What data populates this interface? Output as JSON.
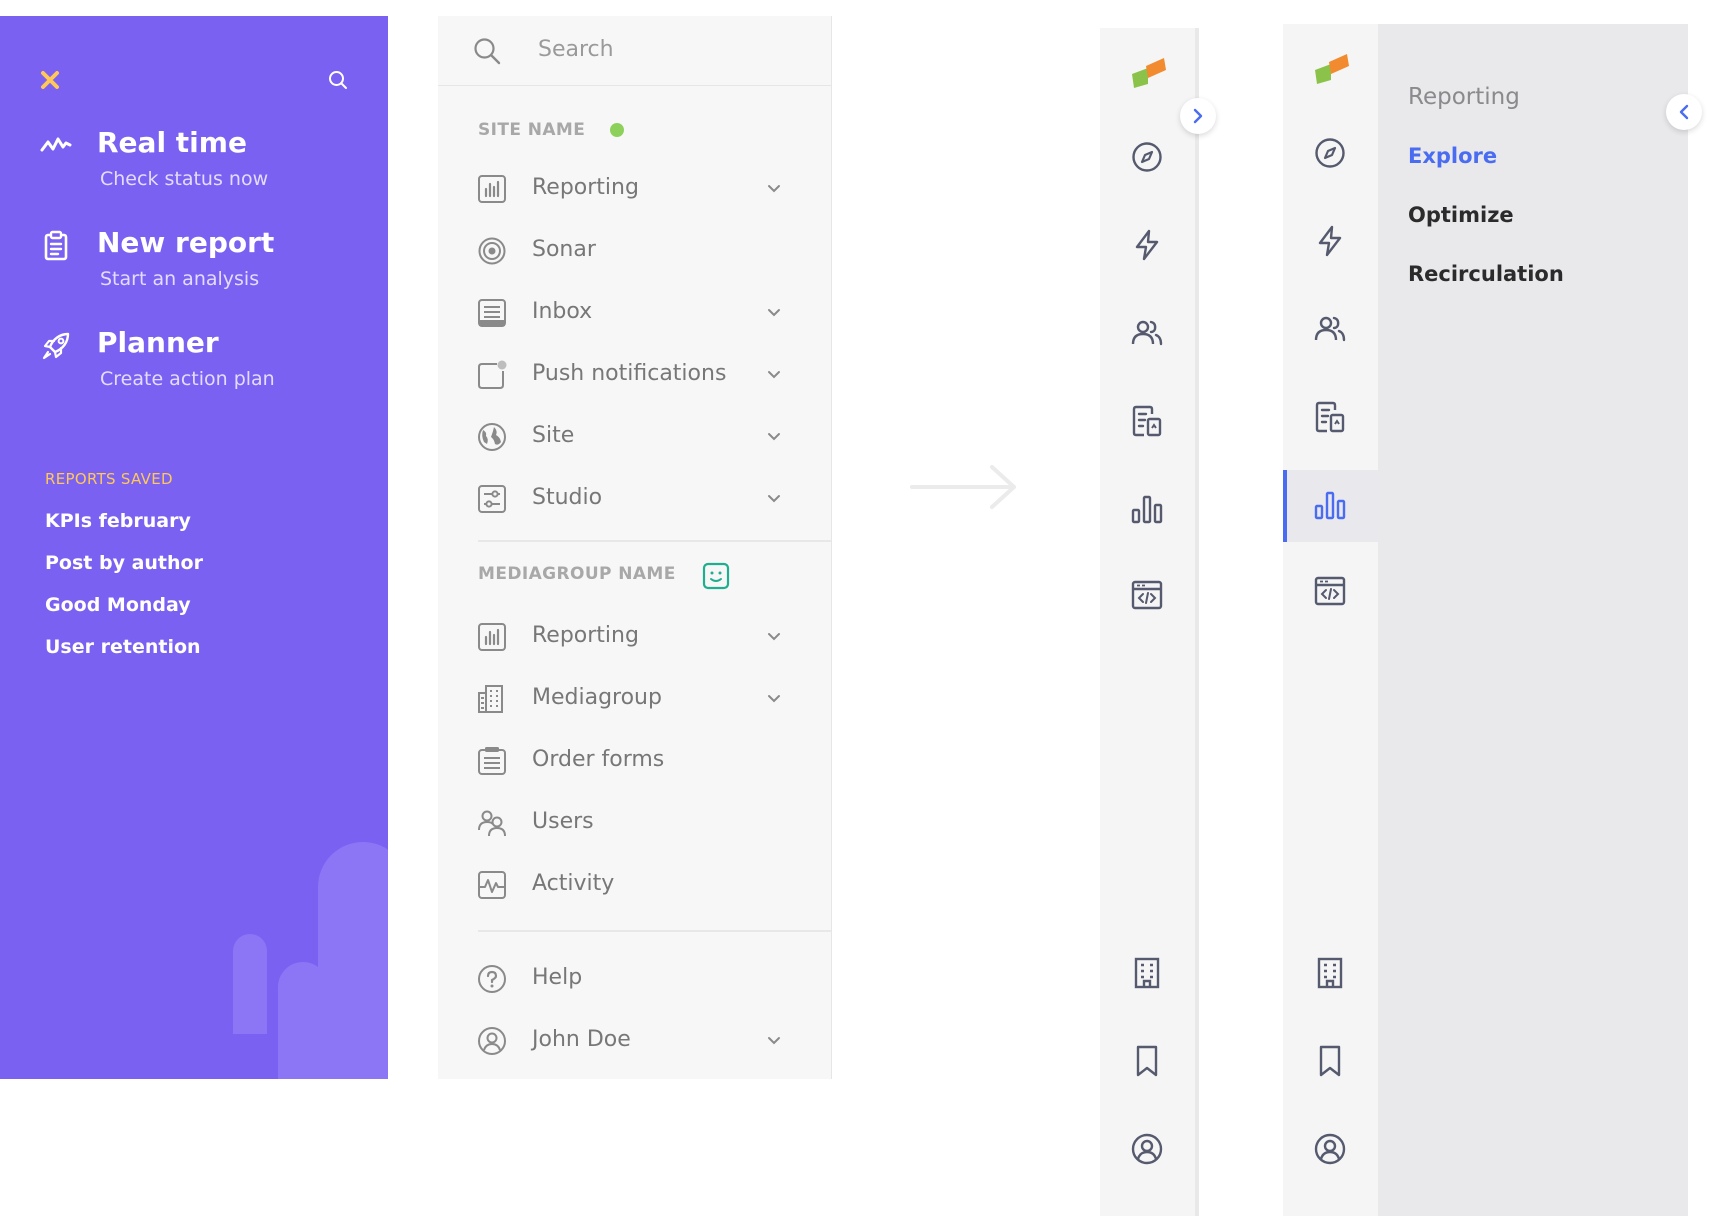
{
  "sidebar_purple": {
    "actions": [
      {
        "title": "Real time",
        "subtitle": "Check status now",
        "icon": "pulse-icon"
      },
      {
        "title": "New report",
        "subtitle": "Start an analysis",
        "icon": "clipboard-icon"
      },
      {
        "title": "Planner",
        "subtitle": "Create action plan",
        "icon": "rocket-icon"
      }
    ],
    "saved_header": "REPORTS SAVED",
    "saved_reports": [
      "KPIs february",
      "Post by author",
      "Good Monday",
      "User retention"
    ],
    "colors": {
      "background": "#7b61f2",
      "accent": "#ffc857"
    }
  },
  "menu": {
    "search_placeholder": "Search",
    "site_section": {
      "label": "SITE NAME",
      "items": [
        {
          "label": "Reporting",
          "icon": "bar-chart-icon",
          "has_chevron": true
        },
        {
          "label": "Sonar",
          "icon": "target-icon",
          "has_chevron": false
        },
        {
          "label": "Inbox",
          "icon": "inbox-icon",
          "has_chevron": true
        },
        {
          "label": "Push notifications",
          "icon": "notification-icon",
          "has_chevron": true
        },
        {
          "label": "Site",
          "icon": "globe-icon",
          "has_chevron": true
        },
        {
          "label": "Studio",
          "icon": "sliders-icon",
          "has_chevron": true
        }
      ]
    },
    "mediagroup_section": {
      "label": "MEDIAGROUP NAME",
      "items": [
        {
          "label": "Reporting",
          "icon": "bar-chart-icon",
          "has_chevron": true
        },
        {
          "label": "Mediagroup",
          "icon": "building-icon",
          "has_chevron": true
        },
        {
          "label": "Order forms",
          "icon": "form-icon",
          "has_chevron": false
        },
        {
          "label": "Users",
          "icon": "users-icon",
          "has_chevron": false
        },
        {
          "label": "Activity",
          "icon": "activity-icon",
          "has_chevron": false
        }
      ]
    },
    "footer_items": [
      {
        "label": "Help",
        "icon": "help-icon",
        "has_chevron": false
      },
      {
        "label": "John Doe",
        "icon": "user-icon",
        "has_chevron": true
      }
    ]
  },
  "subpanel": {
    "title": "Reporting",
    "items": [
      {
        "label": "Explore",
        "active": true
      },
      {
        "label": "Optimize",
        "active": false
      },
      {
        "label": "Recirculation",
        "active": false
      }
    ],
    "accent": "#4a6cf0"
  }
}
